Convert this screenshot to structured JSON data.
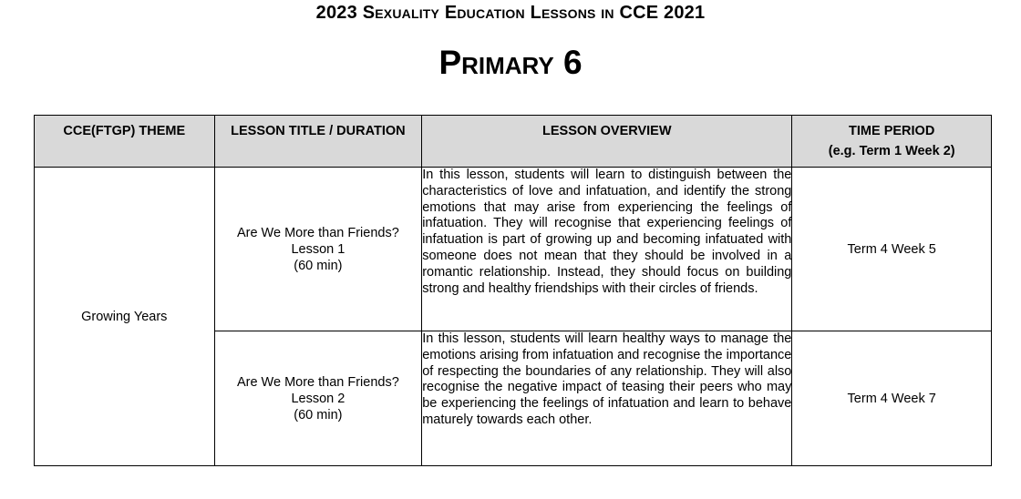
{
  "document": {
    "title": "2023 Sexuality Education Lessons in CCE 2021",
    "subtitle": "Primary 6"
  },
  "table": {
    "headers": {
      "theme": "CCE(FTGP) THEME",
      "lesson_title": "LESSON TITLE / DURATION",
      "overview": "LESSON OVERVIEW",
      "time_period": "TIME PERIOD",
      "time_period_example": "(e.g. Term 1 Week 2)"
    },
    "theme": "Growing Years",
    "rows": [
      {
        "title": "Are We More than Friends?",
        "lesson": "Lesson 1",
        "duration": "(60 min)",
        "overview": "In this lesson, students will learn to distinguish between the characteristics of love and infatuation, and identify the strong emotions that may arise from experiencing the feelings of infatuation. They will recognise that experiencing feelings of infatuation is part of growing up and becoming infatuated with someone does not mean that they should be involved in a romantic relationship. Instead, they should focus on building strong and healthy friendships with their circles of friends.",
        "time_period": "Term 4 Week 5"
      },
      {
        "title": "Are We More than Friends?",
        "lesson": "Lesson 2",
        "duration": "(60 min)",
        "overview": "In this lesson, students will learn healthy ways to manage the emotions arising from infatuation and recognise the importance of respecting the boundaries of any relationship. They will also recognise the negative impact of teasing their peers who may be experiencing the feelings of infatuation and learn to behave maturely towards each other.",
        "time_period": "Term 4 Week 7"
      }
    ]
  }
}
